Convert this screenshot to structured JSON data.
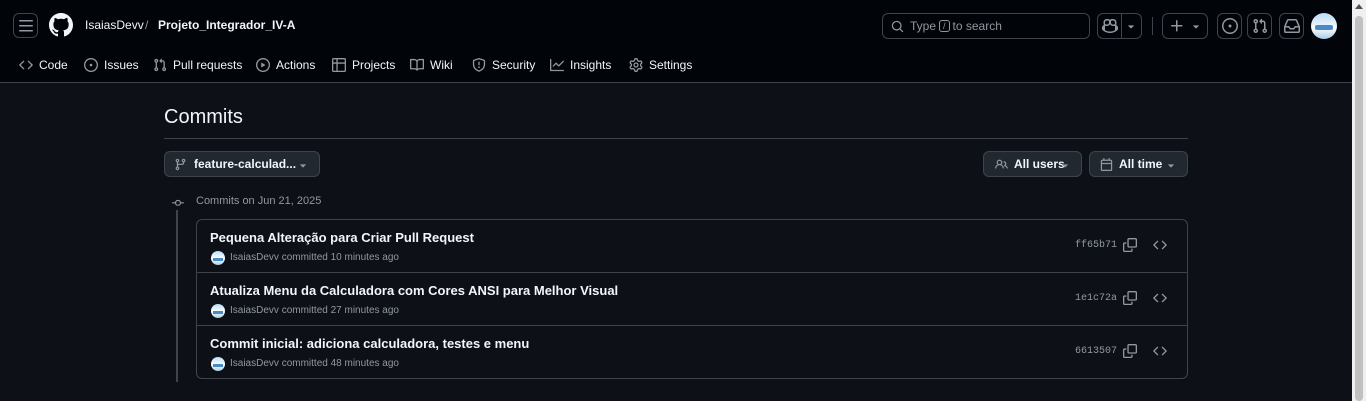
{
  "breadcrumb": {
    "owner": "IsaiasDevv",
    "separator": "/",
    "repo": "Projeto_Integrador_IV-A"
  },
  "search": {
    "prefix": "Type",
    "key": "/",
    "suffix": "to search"
  },
  "repo_nav": [
    {
      "label": "Code",
      "icon": "code-icon"
    },
    {
      "label": "Issues",
      "icon": "issue-opened-icon"
    },
    {
      "label": "Pull requests",
      "icon": "git-pull-request-icon"
    },
    {
      "label": "Actions",
      "icon": "play-icon"
    },
    {
      "label": "Projects",
      "icon": "table-icon"
    },
    {
      "label": "Wiki",
      "icon": "book-icon"
    },
    {
      "label": "Security",
      "icon": "shield-icon"
    },
    {
      "label": "Insights",
      "icon": "graph-icon"
    },
    {
      "label": "Settings",
      "icon": "gear-icon"
    }
  ],
  "page": {
    "title": "Commits"
  },
  "filters": {
    "branch": "feature-calculad...",
    "users": "All users",
    "time": "All time"
  },
  "commit_group": {
    "date_label": "Commits on Jun 21, 2025",
    "commits": [
      {
        "message": "Pequena Alteração para Criar Pull Request",
        "author": "IsaiasDevv",
        "action": "committed",
        "time": "10 minutes ago",
        "sha": "ff65b71"
      },
      {
        "message": "Atualiza Menu da Calculadora com Cores ANSI para Melhor Visual",
        "author": "IsaiasDevv",
        "action": "committed",
        "time": "27 minutes ago",
        "sha": "1e1c72a"
      },
      {
        "message": "Commit inicial: adiciona calculadora, testes e menu",
        "author": "IsaiasDevv",
        "action": "committed",
        "time": "48 minutes ago",
        "sha": "6613507"
      }
    ]
  },
  "colors": {
    "background": "#0d1117",
    "header": "#010409",
    "border": "#3d444d",
    "text": "#f0f6fc",
    "muted": "#9198a1"
  }
}
